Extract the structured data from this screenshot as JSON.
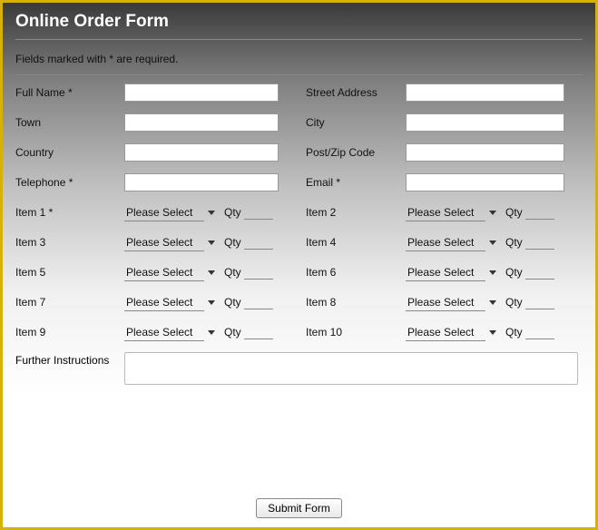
{
  "header": {
    "title": "Online Order Form"
  },
  "required_note": "Fields marked with * are required.",
  "fields": {
    "full_name": "Full Name *",
    "street_address": "Street Address",
    "town": "Town",
    "city": "City",
    "country": "Country",
    "post_zip": "Post/Zip Code",
    "telephone": "Telephone *",
    "email": "Email *"
  },
  "items": {
    "select_placeholder": "Please Select",
    "qty_label": "Qty",
    "item1": "Item 1 *",
    "item2": "Item 2",
    "item3": "Item 3",
    "item4": "Item 4",
    "item5": "Item 5",
    "item6": "Item 6",
    "item7": "Item 7",
    "item8": "Item 8",
    "item9": "Item 9",
    "item10": "Item 10"
  },
  "further_instructions": "Further Instructions",
  "submit": "Submit Form"
}
